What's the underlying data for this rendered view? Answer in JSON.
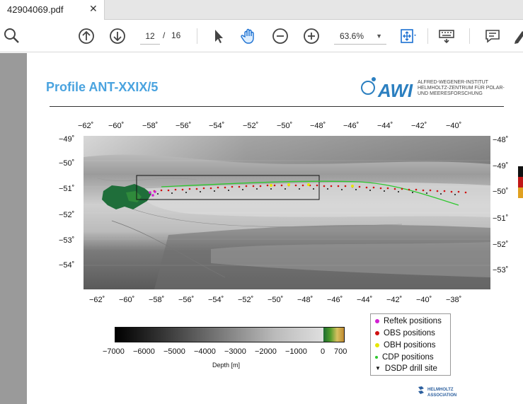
{
  "tab": {
    "title": "42904069.pdf",
    "close_icon": "close-icon"
  },
  "toolbar": {
    "page_current": "12",
    "page_separator": "/",
    "page_total": "16",
    "zoom": "63.6%",
    "icons": [
      "search-icon",
      "page-up-icon",
      "page-down-icon",
      "select-arrow-icon",
      "hand-tool-icon",
      "zoom-out-icon",
      "zoom-in-icon",
      "fit-page-icon",
      "keyboard-icon",
      "comment-icon",
      "sign-icon"
    ]
  },
  "document": {
    "title": "Profile ANT-XXIX/5",
    "institute_line1": "ALFRED-WEGENER-INSTITUT",
    "institute_line2": "HELMHOLTZ-ZENTRUM FÜR POLAR-",
    "institute_line3": "UND MEERESFORSCHUNG",
    "helmholtz_line1": "HELMHOLTZ",
    "helmholtz_line2": "ASSOCIATION",
    "top_lon_ticks": [
      "−62˚",
      "−60˚",
      "−58˚",
      "−56˚",
      "−54˚",
      "−52˚",
      "−50˚",
      "−48˚",
      "−46˚",
      "−44˚",
      "−42˚",
      "−40˚"
    ],
    "bottom_lon_ticks": [
      "−62˚",
      "−60˚",
      "−58˚",
      "−56˚",
      "−54˚",
      "−52˚",
      "−50˚",
      "−48˚",
      "−46˚",
      "−44˚",
      "−42˚",
      "−40˚",
      "−38˚"
    ],
    "left_lat_ticks": [
      "−49˚",
      "−50˚",
      "−51˚",
      "−52˚",
      "−53˚",
      "−54˚"
    ],
    "right_lat_ticks": [
      "−48˚",
      "−49˚",
      "−50˚",
      "−51˚",
      "−52˚",
      "−53˚"
    ],
    "colorbar_ticks": [
      "−7000",
      "−6000",
      "−5000",
      "−4000",
      "−3000",
      "−2000",
      "−1000",
      "0",
      "700"
    ],
    "colorbar_label": "Depth [m]",
    "legend": [
      {
        "label": "Reftek positions",
        "color": "#d21fd2",
        "marker": "dot"
      },
      {
        "label": "OBS positions",
        "color": "#d01010",
        "marker": "dot"
      },
      {
        "label": "OBH positions",
        "color": "#e6e600",
        "marker": "dot"
      },
      {
        "label": "CDP positions",
        "color": "#2ec72e",
        "marker": "dot"
      },
      {
        "label": "DSDP drill site",
        "color": "#111111",
        "marker": "triangle"
      }
    ]
  }
}
